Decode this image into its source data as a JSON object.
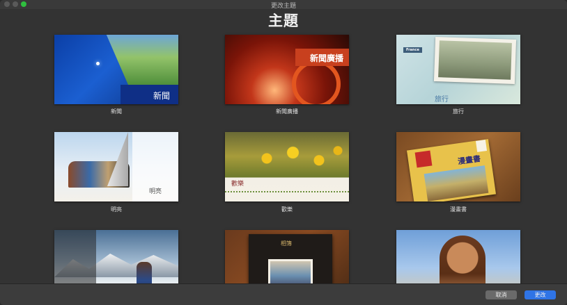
{
  "window": {
    "title": "更改主題",
    "heading": "主題"
  },
  "themes": [
    {
      "name": "新聞",
      "preview_label": "新聞"
    },
    {
      "name": "新聞廣播",
      "preview_label": "新聞廣播"
    },
    {
      "name": "旅行",
      "preview_label": "旅行",
      "tag": "France"
    },
    {
      "name": "明亮",
      "preview_label": "明亮"
    },
    {
      "name": "歡樂",
      "preview_label": "歡樂"
    },
    {
      "name": "漫畫書",
      "preview_label": "漫畫書"
    },
    {
      "name": "",
      "preview_label": ""
    },
    {
      "name": "",
      "preview_label": "相簿"
    },
    {
      "name": "",
      "preview_label": ""
    }
  ],
  "footer": {
    "cancel_label": "取消",
    "change_label": "更改"
  },
  "colors": {
    "primary_button": "#2f74e6",
    "secondary_button": "#6a6a6a",
    "zoom_light": "#2fbf3f"
  }
}
